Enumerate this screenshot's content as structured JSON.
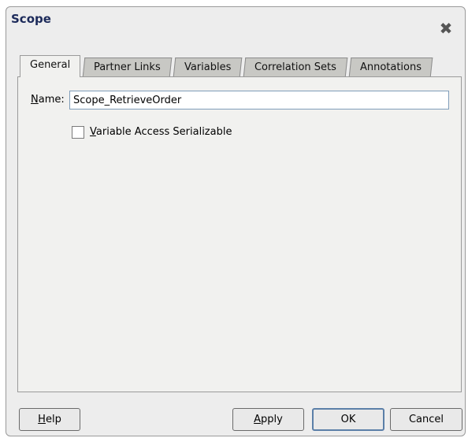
{
  "dialog": {
    "title": "Scope",
    "close_icon": "close-icon"
  },
  "tabs": [
    {
      "label": "General",
      "active": true
    },
    {
      "label": "Partner Links",
      "active": false
    },
    {
      "label": "Variables",
      "active": false
    },
    {
      "label": "Correlation Sets",
      "active": false
    },
    {
      "label": "Annotations",
      "active": false
    }
  ],
  "general": {
    "name_label_mnemonic": "N",
    "name_label_rest": "ame:",
    "name_value": "Scope_RetrieveOrder",
    "checkbox_mnemonic": "V",
    "checkbox_label_rest": "ariable Access Serializable",
    "checkbox_checked": false
  },
  "buttons": {
    "help_mnemonic": "H",
    "help_rest": "elp",
    "apply_mnemonic": "A",
    "apply_rest": "pply",
    "ok": "OK",
    "cancel": "Cancel"
  }
}
